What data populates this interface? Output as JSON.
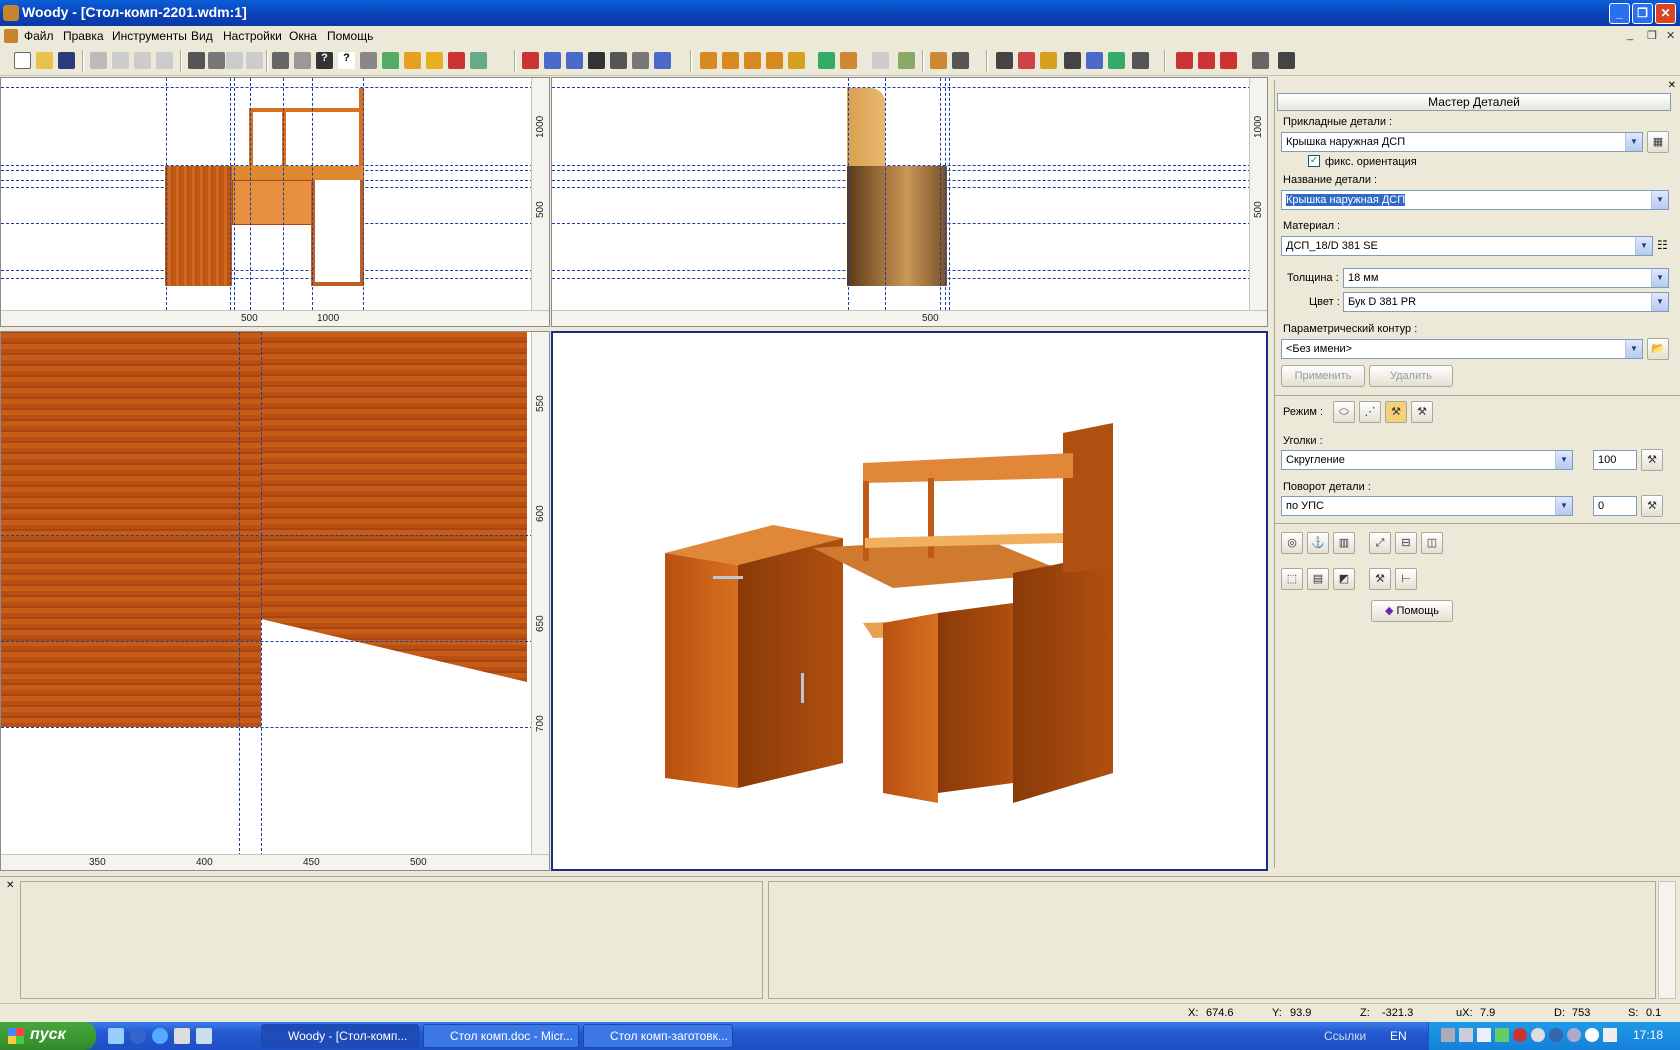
{
  "window": {
    "title": "Woody - [Стол-комп-2201.wdm:1]"
  },
  "menu": [
    "Файл",
    "Правка",
    "Инструменты",
    "Вид",
    "Настройки",
    "Окна",
    "Помощь"
  ],
  "views": {
    "top_left": {
      "ruler_v": [
        "1000",
        "500"
      ],
      "ruler_h": [
        "500",
        "1000"
      ]
    },
    "top_right": {
      "ruler_v": [
        "1000",
        "500"
      ],
      "ruler_h": [
        "500"
      ]
    },
    "bottom_left": {
      "ruler_v": [
        "550",
        "600",
        "650",
        "700"
      ],
      "ruler_h": [
        "350",
        "400",
        "450",
        "500"
      ]
    }
  },
  "panel": {
    "title": "Мастер Деталей",
    "applied_label": "Прикладные детали :",
    "applied_value": "Крышка наружная ДСП",
    "fix_orientation": "фикс. ориентация",
    "fix_orientation_checked": true,
    "name_label": "Название детали :",
    "name_value": "Крышка наружная ДСП",
    "material_label": "Материал :",
    "material_value": "ДСП_18/D 381 SE",
    "thickness_label": "Толщина :",
    "thickness_value": "18 мм",
    "color_label": "Цвет :",
    "color_value": "Бук D 381 PR",
    "contour_label": "Параметрический контур :",
    "contour_value": "<Без имени>",
    "apply_btn": "Применить",
    "delete_btn": "Удалить",
    "mode_label": "Режим :",
    "corners_label": "Уголки :",
    "corners_value": "Скругление",
    "corners_num": "100",
    "rotate_label": "Поворот детали :",
    "rotate_value": "по УПС",
    "rotate_num": "0",
    "help_btn": "Помощь"
  },
  "status": {
    "x_label": "X:",
    "x": "674.6",
    "y_label": "Y:",
    "y": "93.9",
    "z_label": "Z:",
    "z": "-321.3",
    "ux_label": "uX:",
    "ux": "7.9",
    "d_label": "D:",
    "d": "753",
    "s_label": "S:",
    "s": "0.1"
  },
  "taskbar": {
    "start": "пуск",
    "tasks": [
      "Woody - [Стол-комп...",
      "Стол комп.doc - Micr...",
      "Стол комп-заготовк..."
    ],
    "links": "Ссылки",
    "lang": "EN",
    "clock": "17:18"
  }
}
